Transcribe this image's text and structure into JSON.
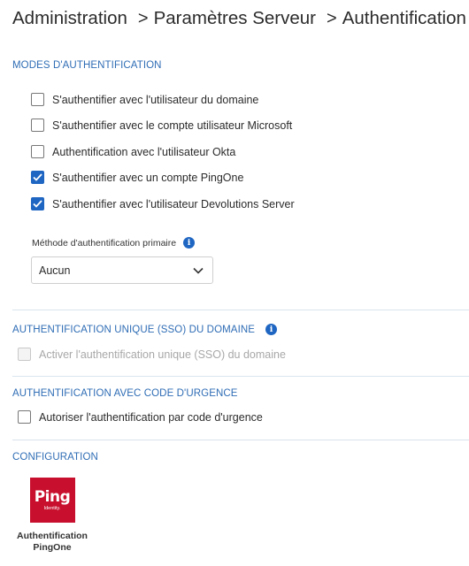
{
  "breadcrumb": {
    "items": [
      "Administration",
      "Paramètres Serveur",
      "Authentification"
    ],
    "separator": ">"
  },
  "auth_modes": {
    "title": "MODES D'AUTHENTIFICATION",
    "options": [
      {
        "label": "S'authentifier avec l'utilisateur du domaine",
        "checked": false
      },
      {
        "label": "S'authentifier avec le compte utilisateur Microsoft",
        "checked": false
      },
      {
        "label": "Authentification avec l'utilisateur Okta",
        "checked": false
      },
      {
        "label": "S'authentifier avec un compte PingOne",
        "checked": true
      },
      {
        "label": "S'authentifier avec l'utilisateur Devolutions Server",
        "checked": true
      }
    ],
    "primary_method": {
      "label": "Méthode d'authentification primaire",
      "value": "Aucun"
    }
  },
  "sso": {
    "title": "AUTHENTIFICATION UNIQUE (SSO) DU DOMAINE",
    "option": {
      "label": "Activer l'authentification unique (SSO) du domaine",
      "checked": false,
      "disabled": true
    }
  },
  "emergency": {
    "title": "AUTHENTIFICATION AVEC CODE D'URGENCE",
    "option": {
      "label": "Autoriser l'authentification par code d'urgence",
      "checked": false
    }
  },
  "configuration": {
    "title": "CONFIGURATION",
    "tile": {
      "logo_word": "Ping",
      "logo_sub": "Identity.",
      "label": "Authentification PingOne"
    }
  },
  "colors": {
    "accent": "#1f66c2",
    "section_title": "#2f6db5",
    "ping_red": "#c8102e"
  }
}
